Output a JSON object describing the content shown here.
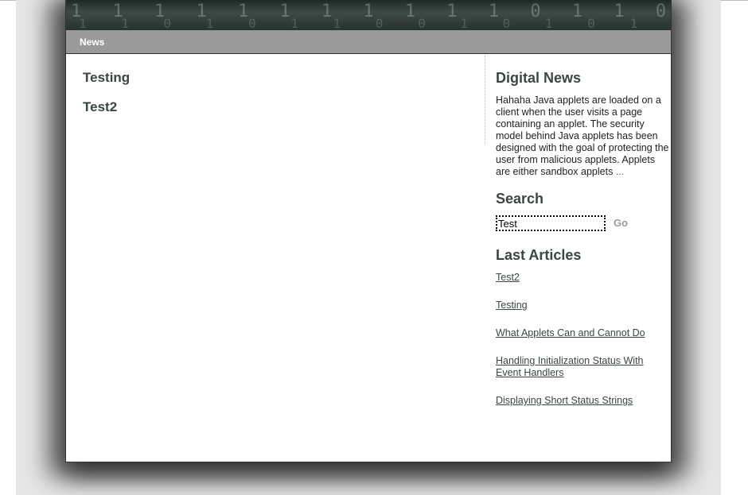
{
  "nav": {
    "items": [
      {
        "label": "News"
      }
    ]
  },
  "main": {
    "articles": [
      {
        "title": "Testing"
      },
      {
        "title": "Test2"
      }
    ]
  },
  "sidebar": {
    "digital_news": {
      "heading": "Digital News",
      "text": "Hahaha Java applets are loaded on a client when the user visits a page containing an applet. The security model behind Java applets has been designed with the goal of protecting the user from malicious applets. Applets are either sandbox applets",
      "more": "..."
    },
    "search": {
      "heading": "Search",
      "value": "Test",
      "button": "Go"
    },
    "last_articles": {
      "heading": "Last Articles",
      "links": [
        "Test2",
        "Testing",
        "What Applets Can and Cannot Do",
        "Handling Initialization Status With Event Handlers",
        "Displaying Short Status Strings"
      ]
    }
  },
  "colors": {
    "heading": "#3b4640",
    "navbar": "#9a9a9a",
    "page_bg": "#e6e6e6"
  }
}
